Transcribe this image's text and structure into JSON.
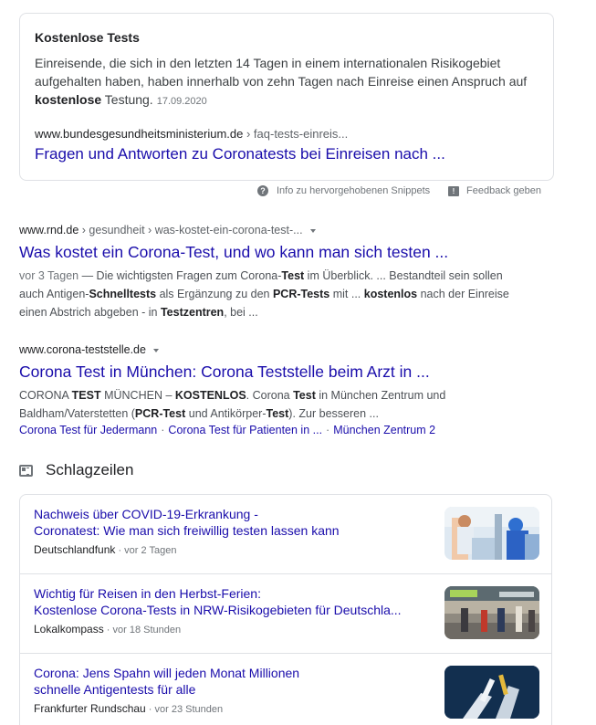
{
  "snippet": {
    "title": "Kostenlose Tests",
    "text_before": "Einreisende, die sich in den letzten 14 Tagen in einem internationalen Risikogebiet aufgehalten haben, haben innerhalb von zehn Tagen nach Einreise einen Anspruch auf ",
    "text_bold": "kostenlose",
    "text_after": " Testung.",
    "date": "17.09.2020",
    "url_domain": "www.bundesgesundheitsministerium.de",
    "url_breadcrumb": " › faq-tests-einreis...",
    "link_title": "Fragen und Antworten zu Coronatests bei Einreisen nach ..."
  },
  "snippet_footer": {
    "info_label": "Info zu hervorgehobenen Snippets",
    "feedback_label": "Feedback geben"
  },
  "results": [
    {
      "url_domain": "www.rnd.de",
      "url_breadcrumb": " › gesundheit › was-kostet-ein-corona-test-...",
      "title": "Was kostet ein Corona-Test, und wo kann man sich testen ...",
      "age": "vor 3 Tagen",
      "desc_parts": [
        " — Die wichtigsten Fragen zum Corona-",
        "Test",
        " im Überblick. ... Bestandteil sein sollen auch Antigen-",
        "Schnelltests",
        " als Ergänzung zu den ",
        "PCR-Tests",
        " mit ... ",
        "kostenlos",
        " nach der Einreise einen Abstrich abgeben - in ",
        "Testzentren",
        ", bei ..."
      ]
    },
    {
      "url_domain": "www.corona-teststelle.de",
      "title": "Corona Test in München: Corona Teststelle beim Arzt in ...",
      "desc_parts": [
        "CORONA ",
        "TEST",
        " MÜNCHEN – ",
        "KOSTENLOS",
        ". Corona ",
        "Test",
        " in München Zentrum und Baldham/Vaterstetten (",
        "PCR-Test",
        " und Antikörper-",
        "Test",
        "). Zur besseren ..."
      ],
      "sitelinks": [
        "Corona Test für Jedermann",
        "Corona Test für Patienten in ...",
        "München Zentrum 2"
      ]
    }
  ],
  "news": {
    "header": "Schlagzeilen",
    "items": [
      {
        "title_line1": "Nachweis über COVID-19-Erkrankung -",
        "title_line2": "Coronatest: Wie man sich freiwillig testen lassen kann",
        "source": "Deutschlandfunk",
        "age": "vor 2 Tagen"
      },
      {
        "title_line1": "Wichtig für Reisen in den Herbst-Ferien:",
        "title_line2": "Kostenlose Corona-Tests in NRW-Risikogebieten für Deutschla...",
        "source": "Lokalkompass",
        "age": "vor 18 Stunden"
      },
      {
        "title_line1": "Corona: Jens Spahn will jeden Monat Millionen",
        "title_line2": "schnelle Antigentests für alle",
        "source": "Frankfurter Rundschau",
        "age": "vor 23 Stunden"
      }
    ]
  }
}
